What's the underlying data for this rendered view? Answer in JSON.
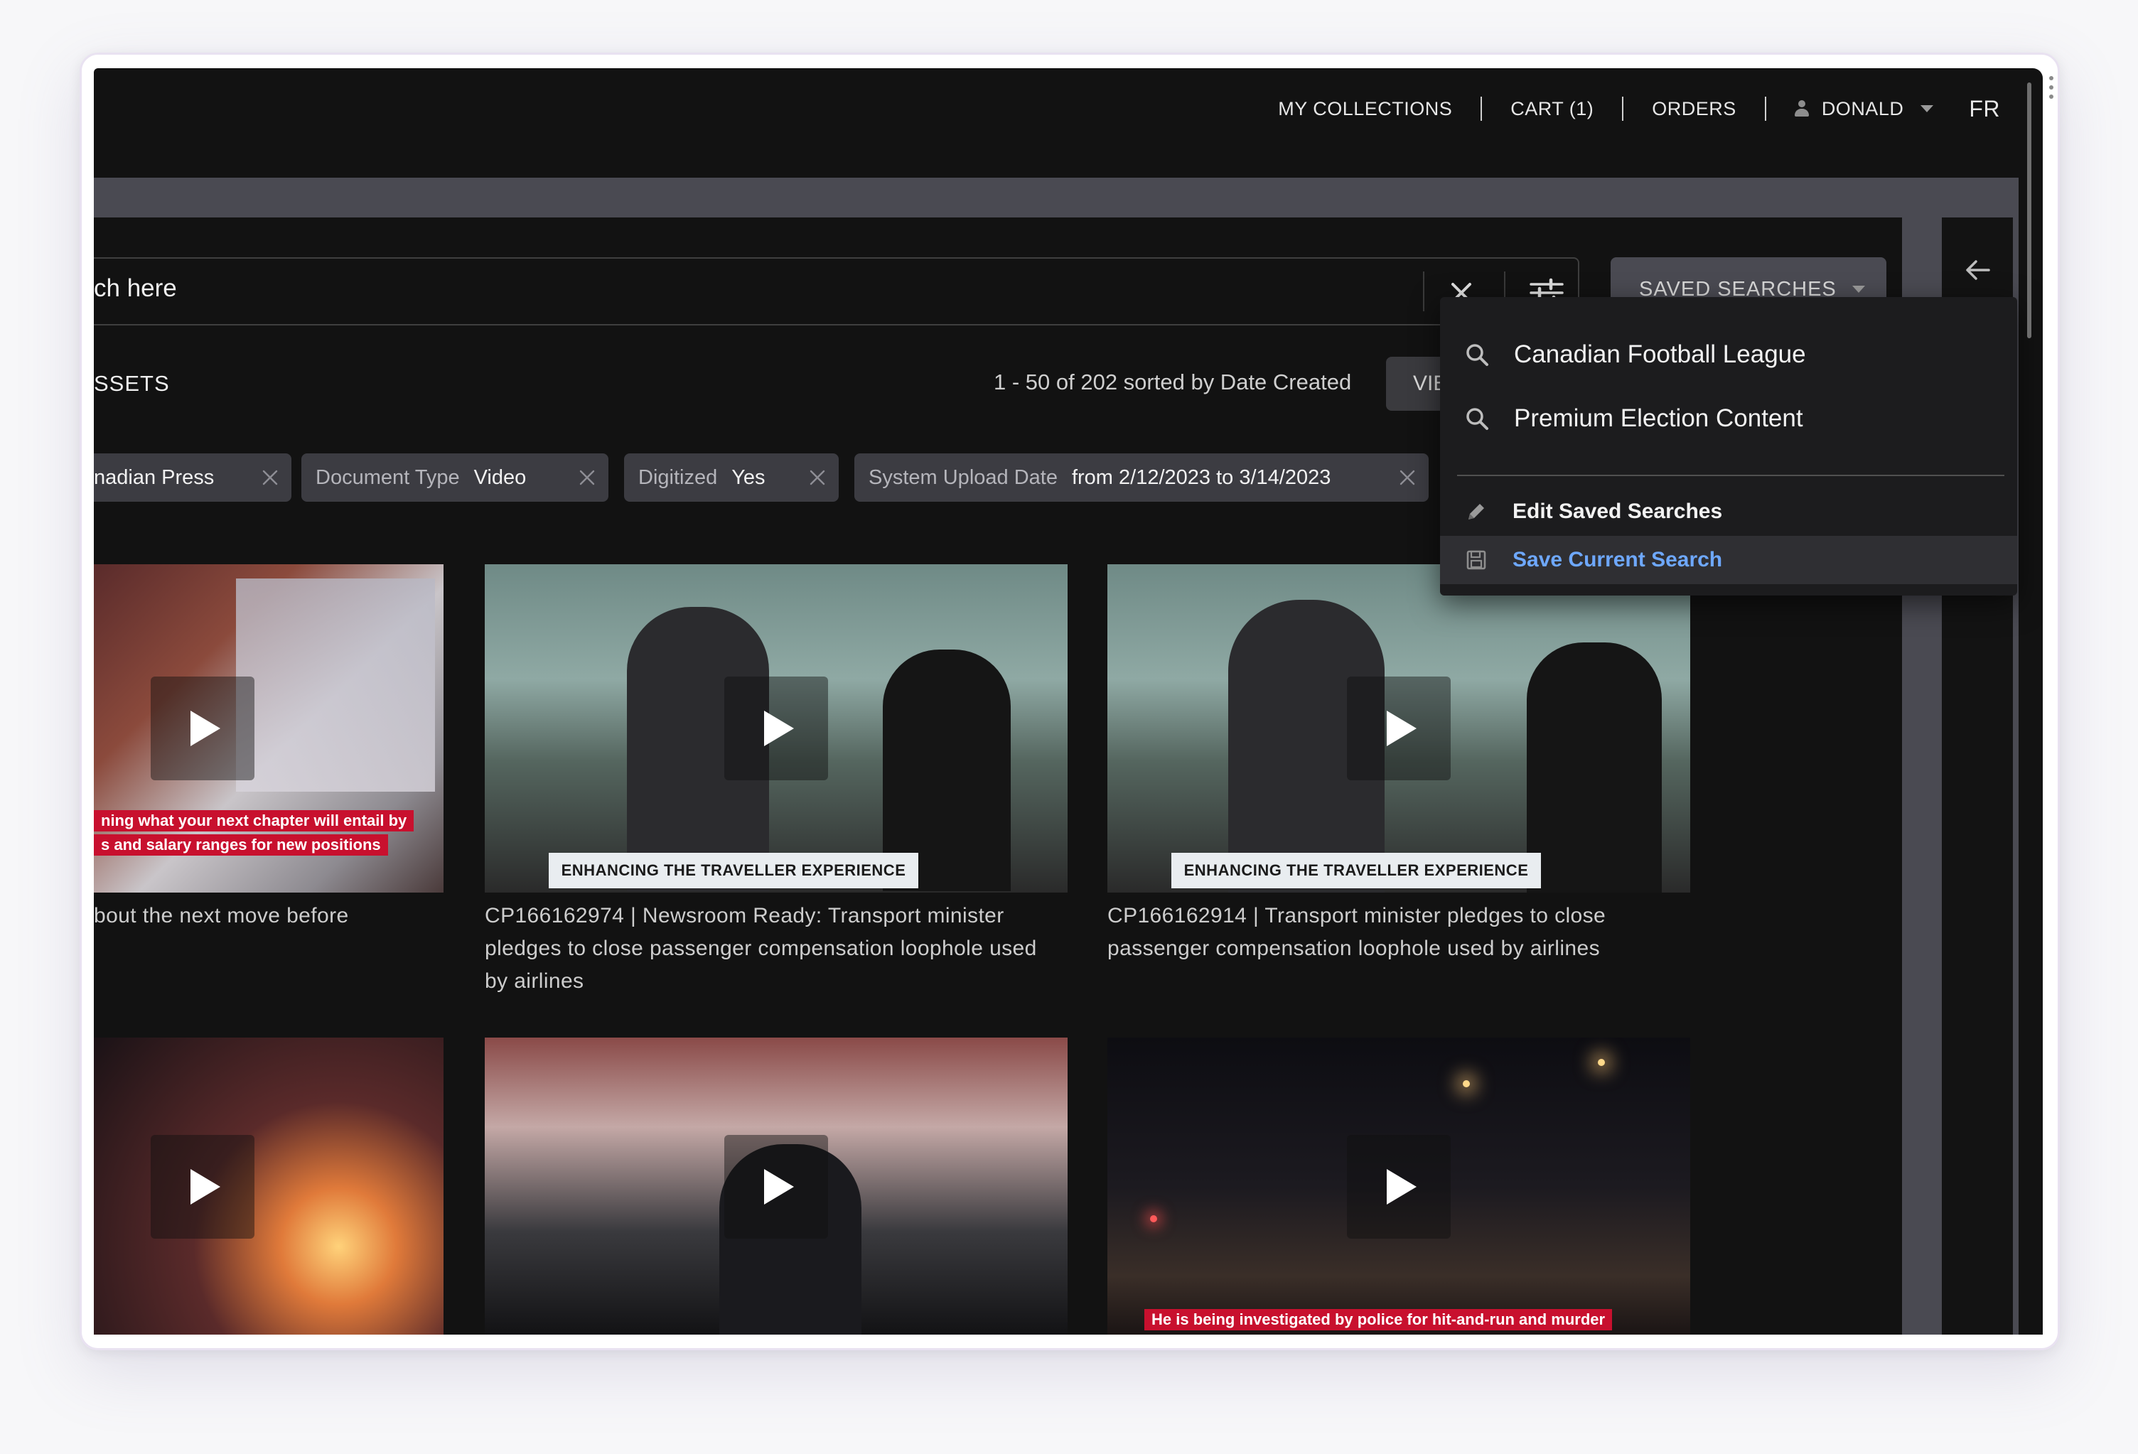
{
  "nav": {
    "my_collections": "MY COLLECTIONS",
    "cart": "CART (1)",
    "orders": "ORDERS",
    "user": "DONALD",
    "language": "FR"
  },
  "search": {
    "text": "ch here",
    "saved_searches_label": "SAVED SEARCHES"
  },
  "results": {
    "section_label": "SSETS",
    "count_text": "1 - 50 of 202 sorted by Date Created",
    "view_label": "VIE"
  },
  "filters": [
    {
      "key": "",
      "value": "nadian Press"
    },
    {
      "key": "Document Type",
      "value": "Video"
    },
    {
      "key": "Digitized",
      "value": "Yes"
    },
    {
      "key": "System Upload Date",
      "value": "from 2/12/2023 to 3/14/2023"
    }
  ],
  "cards": [
    {
      "caption": "bout the next move before",
      "lower_third_1": "ning what your next chapter will entail by",
      "lower_third_2": "s and salary ranges for new positions"
    },
    {
      "caption": "CP166162974 | Newsroom Ready: Transport minister pledges to close passenger compensation loophole used by airlines",
      "banner": "ENHANCING THE TRAVELLER EXPERIENCE"
    },
    {
      "caption": "CP166162914 | Transport minister pledges to close passenger compensation loophole used by airlines",
      "banner": "ENHANCING THE TRAVELLER EXPERIENCE"
    },
    {
      "caption": ""
    },
    {
      "caption": ""
    },
    {
      "caption": "",
      "lower_third_1": "He is being investigated by police for hit-and-run and murder"
    }
  ],
  "saved_searches": {
    "items": [
      "Canadian Football League",
      "Premium Election Content"
    ],
    "edit_label": "Edit Saved Searches",
    "save_label": "Save Current Search"
  },
  "colors": {
    "app_bg": "#121212",
    "panel_gray": "#4a4a52",
    "chip_bg": "#3c3c42",
    "link_blue": "#6ea8ff",
    "news_red": "#c8102e"
  }
}
